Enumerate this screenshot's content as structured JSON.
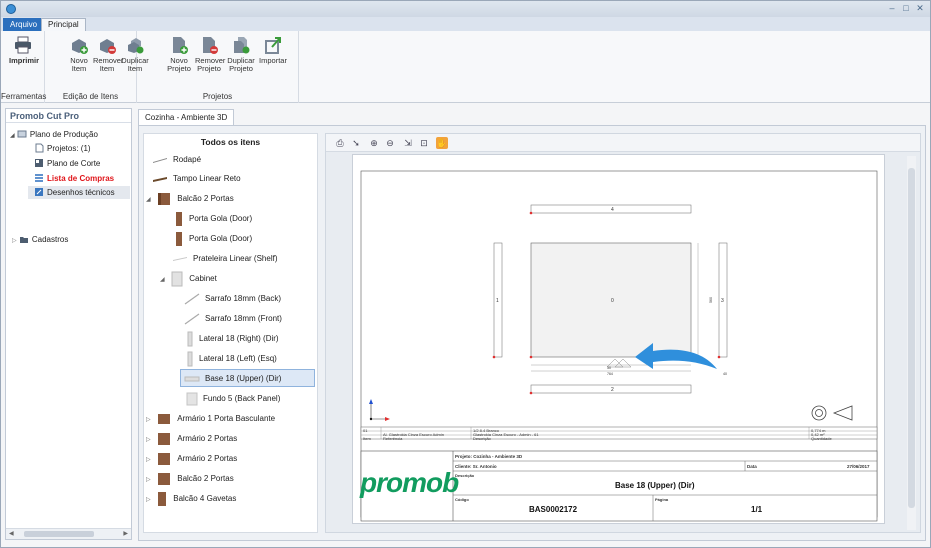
{
  "ribbon": {
    "tabs": [
      {
        "label": "Arquivo",
        "active": true
      },
      {
        "label": "Principal",
        "active": false
      }
    ],
    "groups": [
      {
        "label": "Ferramentas",
        "buttons": [
          {
            "label": "Imprimir"
          }
        ]
      },
      {
        "label": "Edição de Itens",
        "buttons": [
          {
            "label": "Novo\nItem"
          },
          {
            "label": "Remover\nItem"
          },
          {
            "label": "Duplicar\nItem"
          }
        ]
      },
      {
        "label": "Projetos",
        "buttons": [
          {
            "label": "Novo\nProjeto"
          },
          {
            "label": "Remover\nProjeto"
          },
          {
            "label": "Duplicar\nProjeto"
          },
          {
            "label": "Importar"
          }
        ]
      }
    ]
  },
  "left_panel": {
    "title": "Promob Cut Pro",
    "tree": {
      "root": "Plano de Produção",
      "children": [
        "Projetos: (1)",
        "Plano de Corte",
        "Lista de Compras",
        "Desenhos técnicos"
      ],
      "cadastros": "Cadastros"
    }
  },
  "doc_tab": "Cozinha - Ambiente 3D",
  "items_panel": {
    "header": "Todos os itens",
    "items": [
      {
        "label": "Rodapé"
      },
      {
        "label": "Tampo Linear Reto"
      },
      {
        "label": "Balcão 2 Portas"
      },
      {
        "label": "Porta Gola (Door)"
      },
      {
        "label": "Porta Gola (Door)"
      },
      {
        "label": "Prateleira Linear (Shelf)"
      },
      {
        "label": "Cabinet"
      },
      {
        "label": "Sarrafo 18mm (Back)"
      },
      {
        "label": "Sarrafo 18mm (Front)"
      },
      {
        "label": "Lateral 18 (Right) (Dir)"
      },
      {
        "label": "Lateral 18 (Left) (Esq)"
      },
      {
        "label": "Base 18 (Upper) (Dir)"
      },
      {
        "label": "Fundo 5 (Back Panel)"
      },
      {
        "label": "Armário 1 Porta Basculante"
      },
      {
        "label": "Armário 2 Portas"
      },
      {
        "label": "Armário 2 Portas"
      },
      {
        "label": "Balcão 2 Portas"
      },
      {
        "label": "Balcão 4 Gavetas"
      }
    ]
  },
  "drawing": {
    "labels": {
      "top": "4",
      "left": "1",
      "center": "0",
      "right": "3",
      "bottom": "2"
    },
    "dims": {
      "inner_height": "560",
      "bottom_a": "30",
      "bottom_b": "764",
      "right_small": "40"
    },
    "title_block": {
      "row1": [
        "01",
        "1/2 8.4 Branco",
        "0,774 m"
      ],
      "row2": [
        "",
        "Al. Glastrokia Cinza Escuro Admin",
        "Glastrokia Cinza Escuro - Admin - 61",
        "0,42 m²"
      ],
      "row3": [
        "Item",
        "Referência",
        "Descrição",
        "Quantidade"
      ],
      "projeto": "Projeto: Cozinha - Ambiente 3D",
      "cliente": "Cliente: Sr. Antonio",
      "data_label": "Data",
      "data_value": "27/06/2017",
      "descricao_label": "Descrição",
      "descricao_value": "Base 18 (Upper) (Dir)",
      "codigo_label": "Código",
      "codigo_value": "BAS0002172",
      "pagina_label": "Página",
      "pagina_value": "1/1",
      "logo": "promob"
    }
  }
}
